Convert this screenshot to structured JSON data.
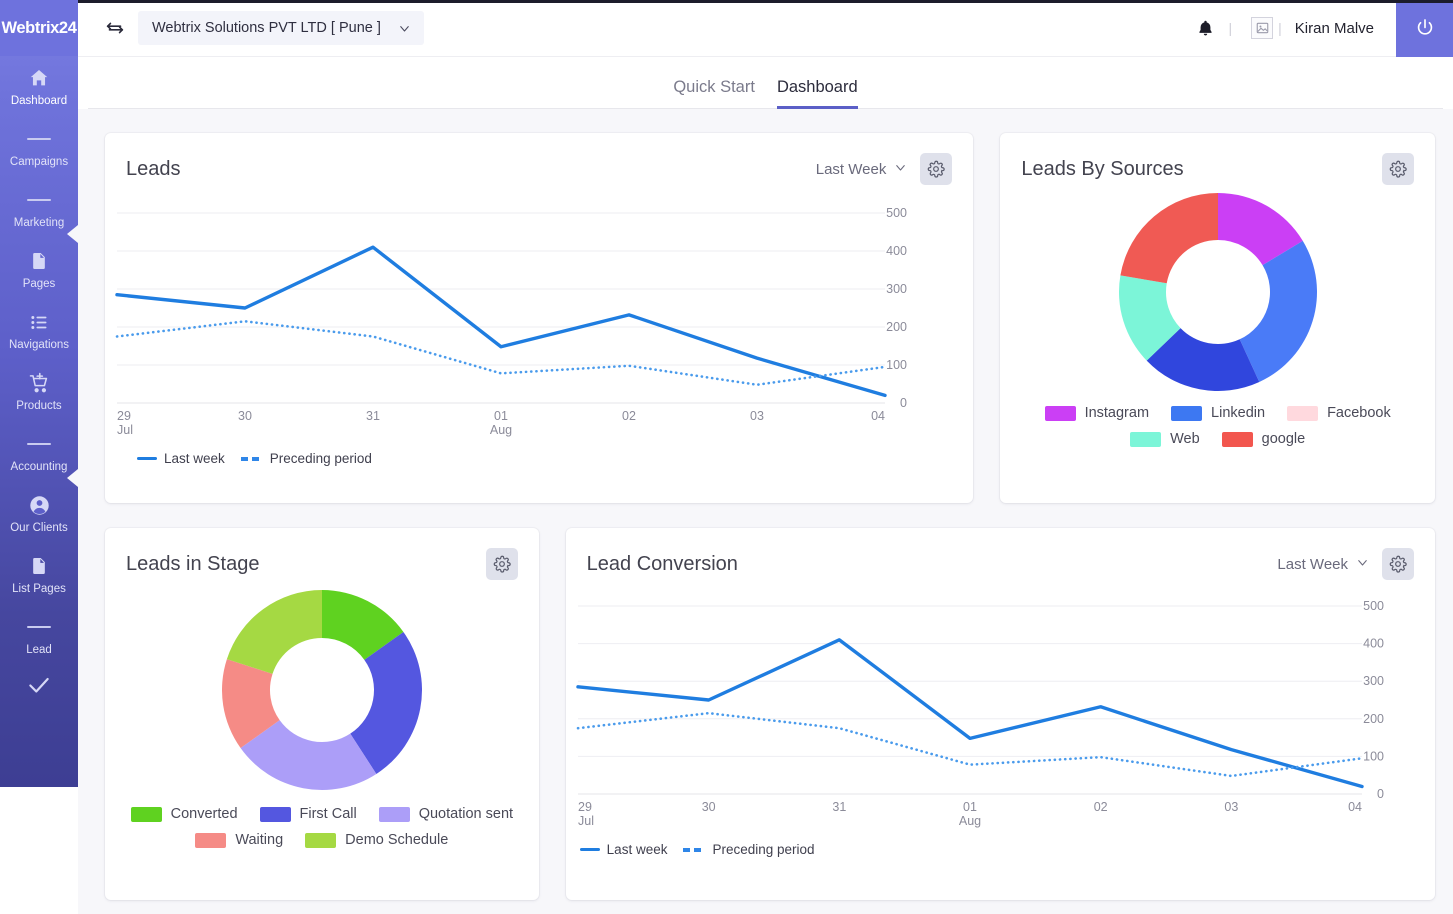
{
  "brand": {
    "name": "Webtrix24"
  },
  "topbar": {
    "swap_icon": "swap-horizontal-icon",
    "company": "Webtrix Solutions PVT LTD [ Pune ]",
    "caret_icon": "chevron-down-icon",
    "bell_icon": "bell-icon",
    "avatar_icon": "broken-image-icon",
    "separator": "|",
    "user_name": "Kiran Malve",
    "power_icon": "power-icon"
  },
  "sidebar": {
    "items": [
      {
        "label": "Dashboard",
        "icon": "home-icon",
        "active": true
      },
      {
        "label": "Campaigns",
        "icon": "dash-icon",
        "active": false
      },
      {
        "label": "Marketing",
        "icon": "dash-icon",
        "active": false
      },
      {
        "label": "Pages",
        "icon": "document-icon",
        "active": false
      },
      {
        "label": "Navigations",
        "icon": "list-icon",
        "active": false
      },
      {
        "label": "Products",
        "icon": "cart-plus-icon",
        "active": false
      },
      {
        "label": "Accounting",
        "icon": "dash-icon",
        "active": false
      },
      {
        "label": "Our Clients",
        "icon": "user-circle-icon",
        "active": false
      },
      {
        "label": "List Pages",
        "icon": "document-icon",
        "active": false
      },
      {
        "label": "Lead",
        "icon": "dash-icon",
        "active": false
      }
    ],
    "footer_icon": "check-icon"
  },
  "tabs": [
    {
      "label": "Quick Start",
      "active": false
    },
    {
      "label": "Dashboard",
      "active": true
    }
  ],
  "cards": {
    "leads": {
      "title": "Leads",
      "range": "Last Week",
      "caret_icon": "chevron-down-icon",
      "gear_icon": "gear-icon"
    },
    "leads_by_sources": {
      "title": "Leads By Sources",
      "gear_icon": "gear-icon"
    },
    "leads_in_stage": {
      "title": "Leads in Stage",
      "gear_icon": "gear-icon"
    },
    "lead_conversion": {
      "title": "Lead Conversion",
      "range": "Last Week",
      "caret_icon": "chevron-down-icon",
      "gear_icon": "gear-icon"
    }
  },
  "colors": {
    "accent": "#6e72dd",
    "line_solid": "#1f7de0",
    "line_dotted": "#4a9bec",
    "gear_bg": "#dfe1eb",
    "page_bg": "#f7f7fa"
  },
  "chart_data": [
    {
      "id": "leads",
      "type": "line",
      "title": "Leads",
      "xlabel": "",
      "ylabel": "",
      "ylim": [
        0,
        500
      ],
      "yticks": [
        0,
        100,
        200,
        300,
        400,
        500
      ],
      "grid": true,
      "legend_position": "bottom-left",
      "categories": [
        "29",
        "30",
        "31",
        "01",
        "02",
        "03",
        "04"
      ],
      "category_months": [
        "Jul",
        "",
        "",
        "Aug",
        "",
        "",
        ""
      ],
      "series": [
        {
          "name": "Last week",
          "style": "solid",
          "color": "#1f7de0",
          "values": [
            285,
            250,
            410,
            148,
            232,
            118,
            20
          ]
        },
        {
          "name": "Preceding period",
          "style": "dotted",
          "color": "#4a9bec",
          "values": [
            175,
            215,
            175,
            78,
            98,
            48,
            95
          ]
        }
      ]
    },
    {
      "id": "leads_by_sources",
      "type": "pie",
      "title": "Leads By Sources",
      "donut": true,
      "legend_position": "bottom",
      "labels": [
        "Instagram",
        "Linkedin",
        "Facebook",
        "Web",
        "google"
      ],
      "colors": [
        "#cb3ff5",
        "#3d78f2",
        "#ffd9de",
        "#7cf5d8",
        "#f2564e"
      ],
      "slice_colors_rendered": [
        "#cb3ff5",
        "#4a7bf7",
        "#3046dd",
        "#7cf5d8",
        "#f05a54"
      ],
      "values": [
        15,
        25,
        19,
        14,
        21
      ],
      "degrees": [
        55,
        90,
        66,
        50,
        75
      ]
    },
    {
      "id": "leads_in_stage",
      "type": "pie",
      "title": "Leads in Stage",
      "donut": true,
      "legend_position": "bottom",
      "labels": [
        "Converted",
        "First Call",
        "Quotation sent",
        "Waiting",
        "Demo Schedule"
      ],
      "colors": [
        "#5fd220",
        "#5457e0",
        "#ac9ef8",
        "#f58b86",
        "#a5d943"
      ],
      "values": [
        15,
        25,
        24,
        14,
        19
      ],
      "degrees": [
        53,
        90,
        85,
        52,
        70
      ]
    },
    {
      "id": "lead_conversion",
      "type": "line",
      "title": "Lead Conversion",
      "xlabel": "",
      "ylabel": "",
      "ylim": [
        0,
        500
      ],
      "yticks": [
        0,
        100,
        200,
        300,
        400,
        500
      ],
      "grid": true,
      "legend_position": "bottom-left",
      "categories": [
        "29",
        "30",
        "31",
        "01",
        "02",
        "03",
        "04"
      ],
      "category_months": [
        "Jul",
        "",
        "",
        "Aug",
        "",
        "",
        ""
      ],
      "series": [
        {
          "name": "Last week",
          "style": "solid",
          "color": "#1f7de0",
          "values": [
            285,
            250,
            410,
            148,
            232,
            118,
            20
          ]
        },
        {
          "name": "Preceding period",
          "style": "dotted",
          "color": "#4a9bec",
          "values": [
            175,
            215,
            175,
            78,
            98,
            48,
            95
          ]
        }
      ]
    }
  ]
}
